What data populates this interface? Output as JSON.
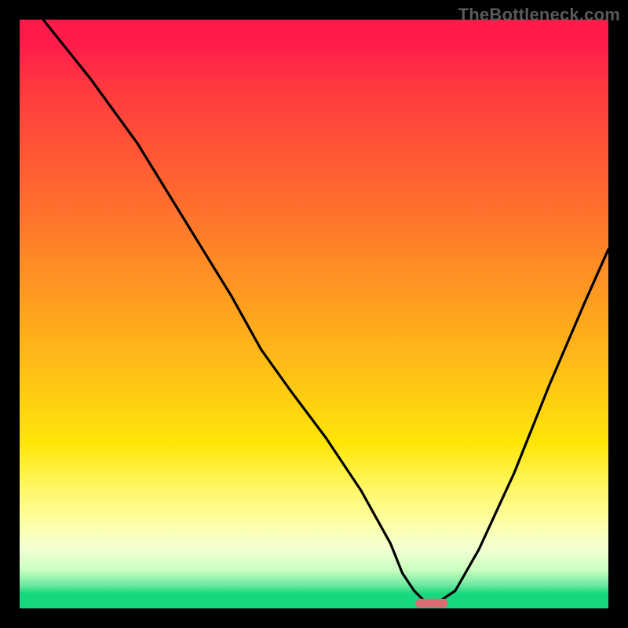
{
  "watermark": {
    "text": "TheBottleneck.com"
  },
  "chart_data": {
    "type": "line",
    "title": "",
    "xlabel": "",
    "ylabel": "",
    "xlim": [
      0,
      100
    ],
    "ylim": [
      0,
      100
    ],
    "grid": false,
    "series": [
      {
        "name": "curve",
        "x": [
          4,
          12,
          20,
          28,
          36,
          41,
          46,
          52,
          58,
          63,
          65,
          67,
          69,
          71,
          74,
          78,
          84,
          90,
          96,
          100
        ],
        "y": [
          100,
          90,
          79,
          66,
          53,
          44,
          37,
          29,
          20,
          11,
          6,
          3,
          1,
          1,
          3,
          10,
          23,
          38,
          52,
          61
        ]
      }
    ],
    "marker": {
      "x": 70,
      "y": 0,
      "color": "#d86c72",
      "width_pct": 5.5,
      "height_pct": 1.5
    },
    "background_gradient": {
      "type": "vertical",
      "stops": [
        {
          "pos": 0.0,
          "color": "#ff1c4b"
        },
        {
          "pos": 0.3,
          "color": "#ff6a2f"
        },
        {
          "pos": 0.55,
          "color": "#ffb21a"
        },
        {
          "pos": 0.72,
          "color": "#ffe608"
        },
        {
          "pos": 0.86,
          "color": "#fcffac"
        },
        {
          "pos": 0.96,
          "color": "#6fe8a0"
        },
        {
          "pos": 1.0,
          "color": "#17d87e"
        }
      ]
    }
  }
}
